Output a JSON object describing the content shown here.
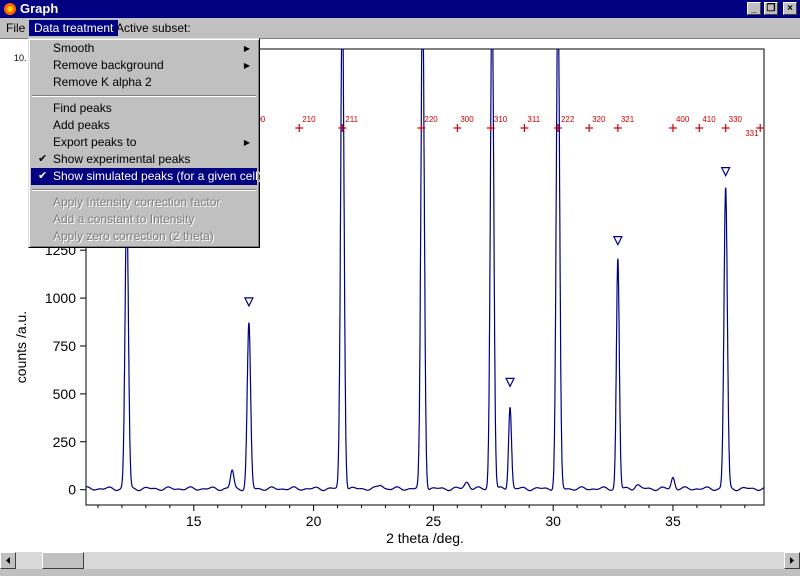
{
  "window": {
    "title": "Graph"
  },
  "menubar": {
    "file": "File",
    "data_treatment": "Data treatment",
    "active_subset": "Active subset:"
  },
  "dropdown": {
    "items": [
      {
        "label": "Smooth",
        "submenu": true
      },
      {
        "label": "Remove background",
        "submenu": true
      },
      {
        "label": "Remove K alpha 2"
      },
      {
        "label": "Find peaks"
      },
      {
        "label": "Add peaks"
      },
      {
        "label": "Export peaks to",
        "submenu": true
      },
      {
        "label": "Show experimental peaks",
        "checked": true
      },
      {
        "label": "Show simulated peaks (for a given cell)",
        "checked": true,
        "highlighted": true
      },
      {
        "label": "Apply Intensity correction factor",
        "disabled": true
      },
      {
        "label": "Add a constant to Intensity",
        "disabled": true
      },
      {
        "label": "Apply zero correction (2 theta)",
        "disabled": true
      }
    ]
  },
  "chart_data": {
    "type": "line",
    "xlabel": "2 theta /deg.",
    "ylabel": "counts /a.u.",
    "xlim": [
      10.5,
      38.8
    ],
    "ylim": [
      -80,
      2300
    ],
    "xticks": [
      15,
      20,
      25,
      30,
      35
    ],
    "yticks": [
      0,
      250,
      500,
      750,
      1000,
      1250
    ],
    "y_top_label": "10.",
    "color": "#000080",
    "peak_color": "#cc0000",
    "series": [
      {
        "peaks": [
          {
            "x": 12.2,
            "h": 1480,
            "w": 0.07
          },
          {
            "x": 16.6,
            "h": 95,
            "w": 0.07
          },
          {
            "x": 17.3,
            "h": 860,
            "w": 0.07
          },
          {
            "x": 21.2,
            "h": 2600,
            "w": 0.07
          },
          {
            "x": 22.8,
            "h": 20,
            "w": 0.1
          },
          {
            "x": 24.55,
            "h": 2600,
            "w": 0.07
          },
          {
            "x": 26.4,
            "h": 35,
            "w": 0.1
          },
          {
            "x": 27.45,
            "h": 2600,
            "w": 0.07
          },
          {
            "x": 28.2,
            "h": 430,
            "w": 0.06
          },
          {
            "x": 30.2,
            "h": 2600,
            "w": 0.07
          },
          {
            "x": 32.7,
            "h": 1200,
            "w": 0.06
          },
          {
            "x": 33.5,
            "h": 20,
            "w": 0.1
          },
          {
            "x": 35.0,
            "h": 60,
            "w": 0.07
          },
          {
            "x": 37.2,
            "h": 1570,
            "w": 0.07
          }
        ]
      }
    ],
    "experimental_peaks": [
      {
        "x": 12.2,
        "y": 1380
      },
      {
        "x": 17.3,
        "y": 980
      },
      {
        "x": 28.2,
        "y": 560
      },
      {
        "x": 32.7,
        "y": 1300
      },
      {
        "x": 37.2,
        "y": 1660
      }
    ],
    "simulated_peaks": [
      {
        "x": 17.3,
        "label": "200"
      },
      {
        "x": 19.4,
        "label": "210"
      },
      {
        "x": 21.2,
        "label": "211"
      },
      {
        "x": 24.5,
        "label": "220"
      },
      {
        "x": 26.0,
        "label": "300"
      },
      {
        "x": 27.4,
        "label": "310"
      },
      {
        "x": 28.8,
        "label": "311"
      },
      {
        "x": 30.2,
        "label": "222"
      },
      {
        "x": 31.5,
        "label": "320"
      },
      {
        "x": 32.7,
        "label": "321"
      },
      {
        "x": 35.0,
        "label": "400"
      },
      {
        "x": 36.1,
        "label": "410"
      },
      {
        "x": 37.2,
        "label": "330"
      },
      {
        "x": 38.1,
        "label": "331"
      }
    ]
  }
}
